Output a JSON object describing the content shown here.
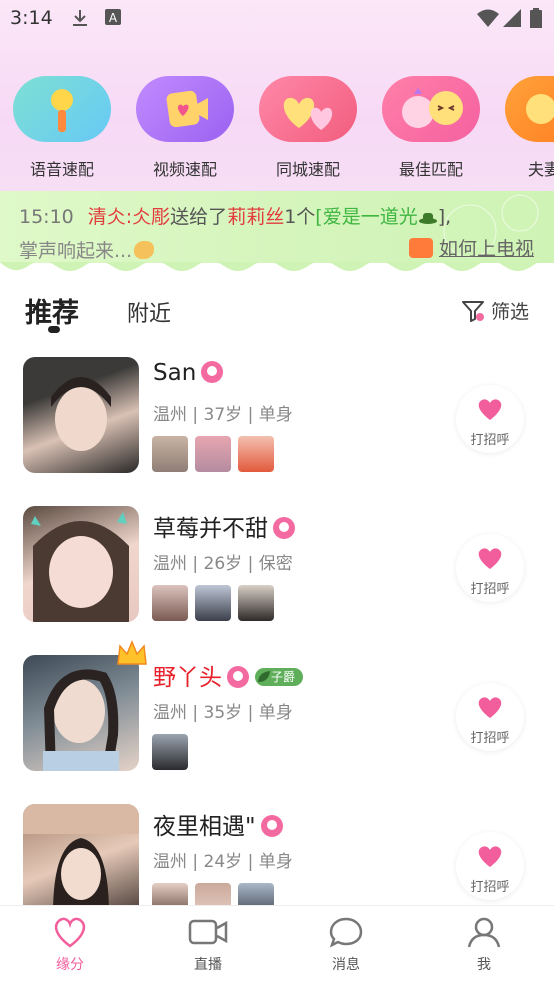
{
  "status_bar": {
    "time": "3:14"
  },
  "quick_match": [
    {
      "label": "语音速配",
      "icon": "microphone-icon",
      "color_from": "#7fe0d3",
      "color_to": "#66c9f5"
    },
    {
      "label": "视频速配",
      "icon": "video-heart-icon",
      "color_from": "#c28bff",
      "color_to": "#9a62f0"
    },
    {
      "label": "同城速配",
      "icon": "two-hearts-icon",
      "color_from": "#ff88a8",
      "color_to": "#f25d7e"
    },
    {
      "label": "最佳匹配",
      "icon": "couple-face-icon",
      "color_from": "#ff7fa8",
      "color_to": "#f561a0"
    },
    {
      "label": "夫妻",
      "icon": "smile-face-icon",
      "color_from": "#ffa23a",
      "color_to": "#ff7a1e"
    }
  ],
  "banner": {
    "time": "15:10",
    "sender": "清仌:仌彫",
    "text1": "送给了",
    "receiver": "莉莉丝",
    "text2": "1个",
    "gift": "[爱是一道光",
    "text3": "],",
    "line2": "掌声响起来...",
    "tv_link": "如何上电视"
  },
  "tabs": {
    "active": "推荐",
    "nearby": "附近",
    "filter": "筛选"
  },
  "greet_label": "打招呼",
  "users": [
    {
      "name": "San",
      "meta": "温州 | 37岁 | 单身",
      "name_red": false,
      "badge": "",
      "thumbs": 3,
      "avatar_colors": [
        "#3b3a38",
        "#d9c1b5"
      ],
      "thumb_colors": [
        "#c9b3a4",
        "#e7a6b0",
        "#e25a3c"
      ]
    },
    {
      "name": "草莓并不甜",
      "meta": "温州 | 26岁 | 保密",
      "name_red": false,
      "badge": "",
      "thumbs": 3,
      "avatar_colors": [
        "#5a4a3f",
        "#f0d6cd"
      ],
      "thumb_colors": [
        "#dcc3be",
        "#bfc6d6",
        "#d9d0c7"
      ]
    },
    {
      "name": "野丫头",
      "meta": "温州 | 35岁 | 单身",
      "name_red": true,
      "badge": "子爵",
      "thumbs": 1,
      "avatar_colors": [
        "#3d4a55",
        "#e5d3c8"
      ],
      "thumb_colors": [
        "#9aa4b0"
      ]
    },
    {
      "name": "夜里相遇\"",
      "meta": "温州 | 24岁 | 单身",
      "name_red": false,
      "badge": "",
      "thumbs": 3,
      "avatar_colors": [
        "#a07f6b",
        "#e6c9b8"
      ],
      "thumb_colors": [
        "#e6cfc5",
        "#caa99a",
        "#a9b8c9"
      ]
    }
  ],
  "bottom_nav": [
    {
      "label": "缘分",
      "icon": "heart-icon",
      "active": true
    },
    {
      "label": "直播",
      "icon": "video-camera-icon",
      "active": false
    },
    {
      "label": "消息",
      "icon": "chat-bubble-icon",
      "active": false
    },
    {
      "label": "我",
      "icon": "person-icon",
      "active": false
    }
  ],
  "colors": {
    "accent": "#f25d9c",
    "banner_bg": "#dff9c8"
  }
}
